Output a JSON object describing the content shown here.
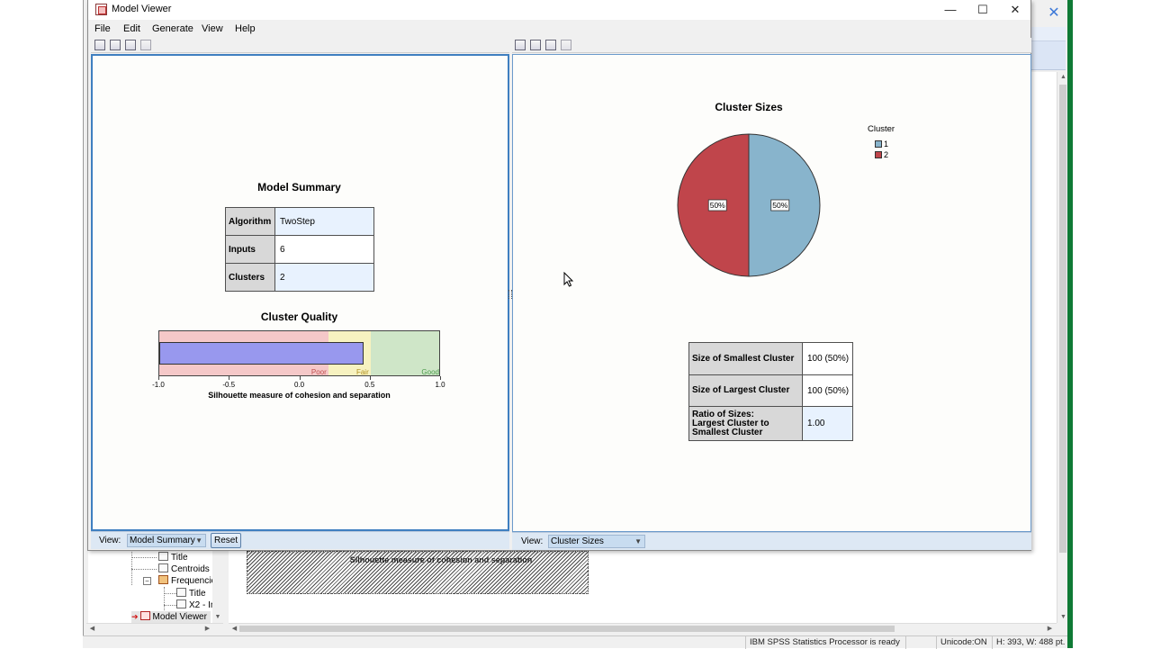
{
  "bg_window": {
    "close_glyph": "✕",
    "tree": {
      "items": [
        "Title",
        "Centroids",
        "Frequencie",
        "Title",
        "X2 - In",
        "Model Viewer"
      ]
    },
    "hatched_label": "Silhouette measure of cohesion and separation",
    "statusbar": {
      "processor": "IBM SPSS Statistics Processor is ready",
      "unicode": "Unicode:ON",
      "dims": "H: 393, W: 488 pt."
    }
  },
  "model_viewer": {
    "title": "Model Viewer",
    "window_controls": {
      "minimize": "—",
      "maximize": "☐",
      "close": "✕"
    },
    "menu": [
      {
        "label": "File"
      },
      {
        "label": "Edit"
      },
      {
        "label": "Generate"
      },
      {
        "label": "View"
      },
      {
        "label": "Help"
      }
    ],
    "left": {
      "summary_title": "Model Summary",
      "summary_rows": [
        {
          "label": "Algorithm",
          "value": "TwoStep"
        },
        {
          "label": "Inputs",
          "value": "6"
        },
        {
          "label": "Clusters",
          "value": "2"
        }
      ],
      "quality_title": "Cluster Quality",
      "quality": {
        "value": 0.45,
        "zones": [
          {
            "label": "Poor",
            "from": -1.0,
            "to": 0.2,
            "color": "#f5c8c8",
            "label_color": "#c05050"
          },
          {
            "label": "Fair",
            "from": 0.2,
            "to": 0.5,
            "color": "#f7f2c0",
            "label_color": "#b09020"
          },
          {
            "label": "Good",
            "from": 0.5,
            "to": 1.0,
            "color": "#cfe6c8",
            "label_color": "#4a9a4a"
          }
        ],
        "ticks": [
          "-1.0",
          "-0.5",
          "0.0",
          "0.5",
          "1.0"
        ],
        "axis_label": "Silhouette measure of cohesion and separation"
      },
      "footer": {
        "view_label": "View:",
        "view_value": "Model Summary",
        "reset_label": "Reset"
      }
    },
    "right": {
      "chart_title": "Cluster Sizes",
      "legend_title": "Cluster",
      "footer": {
        "view_label": "View:",
        "view_value": "Cluster Sizes"
      },
      "sizes_rows": [
        {
          "label": "Size of Smallest Cluster",
          "value": "100 (50%)"
        },
        {
          "label": "Size of Largest Cluster",
          "value": "100 (50%)"
        },
        {
          "label": "Ratio of Sizes: Largest Cluster to Smallest Cluster",
          "label_lines": [
            "Ratio of Sizes:",
            "Largest Cluster to",
            "Smallest Cluster"
          ],
          "value": "1.00"
        }
      ]
    }
  },
  "chart_data": {
    "type": "pie",
    "title": "Cluster Sizes",
    "legend_title": "Cluster",
    "legend_position": "top-right",
    "slices": [
      {
        "name": "1",
        "value": 50,
        "label": "50%",
        "color": "#88b4cc"
      },
      {
        "name": "2",
        "value": 50,
        "label": "50%",
        "color": "#c0454b"
      }
    ]
  }
}
